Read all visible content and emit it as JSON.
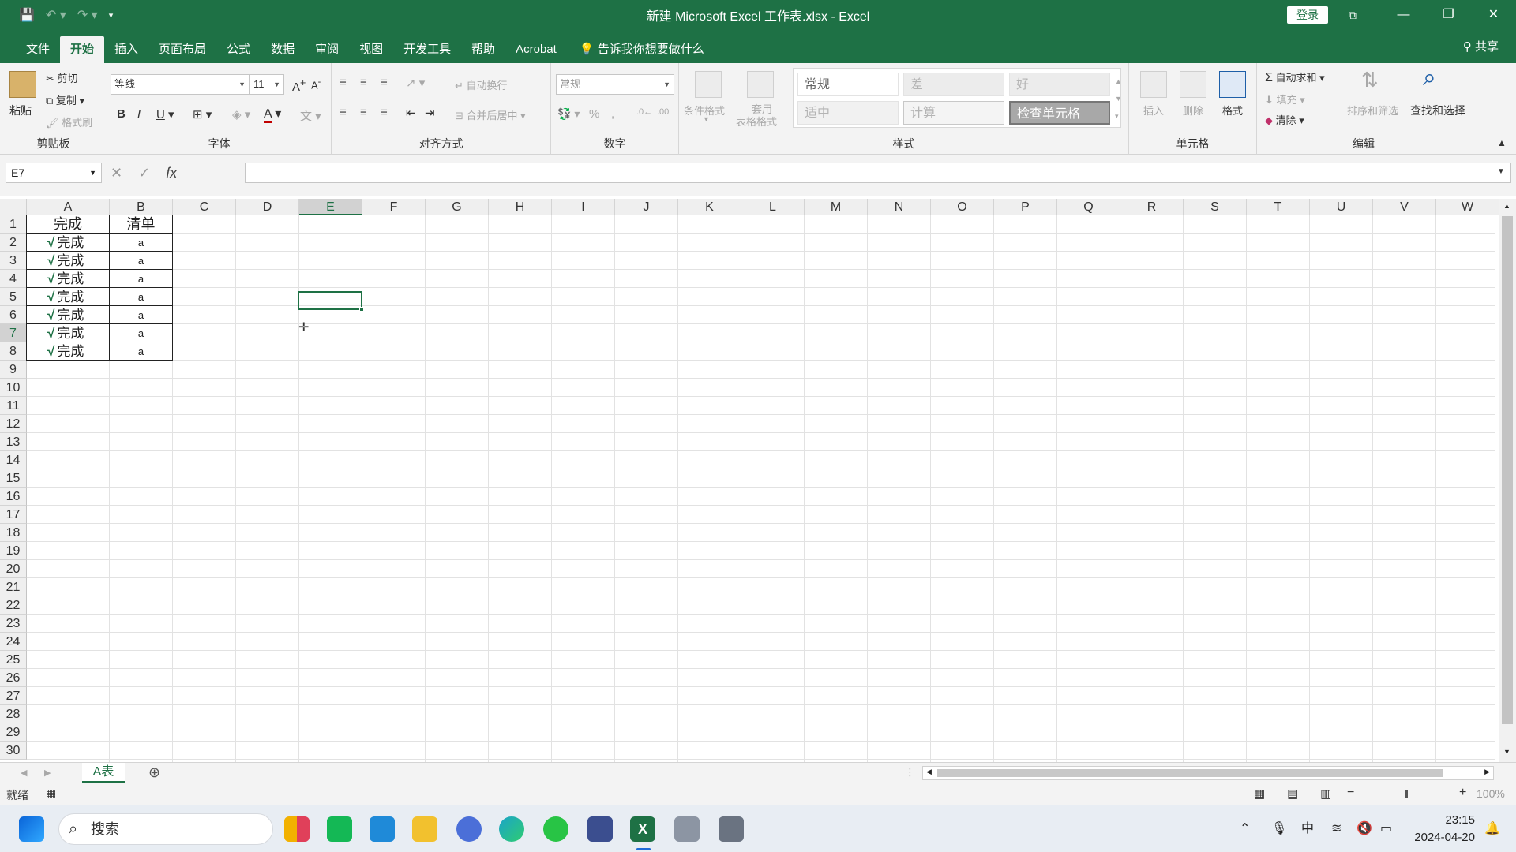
{
  "window": {
    "title": "新建 Microsoft Excel 工作表.xlsx  -  Excel",
    "login_label": "登录"
  },
  "menu": {
    "tabs": [
      "文件",
      "开始",
      "插入",
      "页面布局",
      "公式",
      "数据",
      "审阅",
      "视图",
      "开发工具",
      "帮助",
      "Acrobat"
    ],
    "active_tab": "开始",
    "tell_me": "告诉我你想要做什么",
    "share": "共享"
  },
  "ribbon": {
    "clipboard": {
      "label": "剪贴板",
      "paste": "粘贴",
      "cut": "剪切",
      "copy": "复制",
      "format_painter": "格式刷"
    },
    "font": {
      "label": "字体",
      "name": "等线",
      "size": "11",
      "bold": "B",
      "italic": "I",
      "underline": "U"
    },
    "alignment": {
      "label": "对齐方式",
      "wrap": "自动换行",
      "merge": "合并后居中"
    },
    "number": {
      "label": "数字",
      "format": "常规"
    },
    "styles": {
      "label": "样式",
      "conditional": "条件格式",
      "table_format_1": "套用",
      "table_format_2": "表格格式",
      "gallery": [
        "常规",
        "差",
        "好",
        "适中",
        "计算",
        "检查单元格"
      ]
    },
    "cells": {
      "label": "单元格",
      "insert": "插入",
      "delete": "删除",
      "format": "格式"
    },
    "editing": {
      "label": "编辑",
      "autosum": "自动求和",
      "fill": "填充",
      "clear": "清除",
      "sort": "排序和筛选",
      "find": "查找和选择"
    }
  },
  "formula_bar": {
    "name_box": "E7",
    "formula": ""
  },
  "sheet": {
    "columns": [
      "A",
      "B",
      "C",
      "D",
      "E",
      "F",
      "G",
      "H",
      "I",
      "J",
      "K",
      "L",
      "M",
      "N",
      "O",
      "P",
      "Q",
      "R",
      "S",
      "T",
      "U",
      "V",
      "W"
    ],
    "rows": [
      "1",
      "2",
      "3",
      "4",
      "5",
      "6",
      "7",
      "8",
      "9",
      "10",
      "11",
      "12",
      "13",
      "14",
      "15",
      "16",
      "17",
      "18",
      "19",
      "20",
      "21",
      "22",
      "23",
      "24",
      "25",
      "26",
      "27",
      "28",
      "29",
      "30"
    ],
    "selected_column": "E",
    "selected_row": "7",
    "header_a": "完成",
    "header_b": "清单",
    "check_mark": "√",
    "data": [
      {
        "a": "完成",
        "b": "a"
      },
      {
        "a": "完成",
        "b": "a"
      },
      {
        "a": "完成",
        "b": "a"
      },
      {
        "a": "完成",
        "b": "a"
      },
      {
        "a": "完成",
        "b": "a"
      },
      {
        "a": "完成",
        "b": "a"
      },
      {
        "a": "完成",
        "b": "a"
      }
    ],
    "tab": "A表"
  },
  "status": {
    "ready": "就绪",
    "zoom": "100%"
  },
  "taskbar": {
    "search": "搜索",
    "time": "23:15",
    "date": "2024-04-20",
    "ime": "中"
  }
}
